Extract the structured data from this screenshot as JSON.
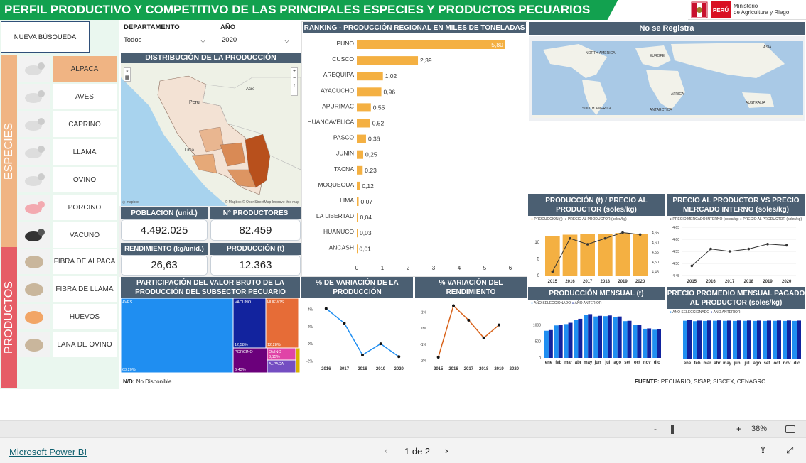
{
  "header": {
    "title": "PERFIL PRODUCTIVO Y COMPETITIVO DE LAS PRINCIPALES ESPECIES Y PRODUCTOS PECUARIOS",
    "logo_country": "PERÚ",
    "logo_ministry_1": "Ministerio",
    "logo_ministry_2": "de Agricultura y Riego"
  },
  "filters": {
    "new_search": "NUEVA BÚSQUEDA",
    "dept_label": "DEPARTAMENTO",
    "dept_value": "Todos",
    "year_label": "AÑO",
    "year_value": "2020"
  },
  "side": {
    "especies": "ESPECIES",
    "productos": "PRODUCTOS"
  },
  "species": [
    "ALPACA",
    "AVES",
    "CAPRINO",
    "LLAMA",
    "OVINO",
    "PORCINO",
    "VACUNO"
  ],
  "products": [
    "FIBRA DE ALPACA",
    "FIBRA DE LLAMA",
    "HUEVOS",
    "LANA DE OVINO"
  ],
  "map": {
    "title": "DISTRIBUCIÓN DE LA PRODUCCIÓN",
    "country": "Peru",
    "city": "Lima",
    "region_label": "Acre",
    "attribution": "© Mapbox © OpenStreetMap Improve this map"
  },
  "kpis": {
    "poblacion_label": "POBLACION (unid.)",
    "poblacion_value": "4.492.025",
    "productores_label": "N° PRODUCTORES",
    "productores_value": "82.459",
    "rendimiento_label": "RENDIMIENTO (kg/unid.)",
    "rendimiento_value": "26,63",
    "produccion_label": "PRODUCCIÓN (t)",
    "produccion_value": "12.363"
  },
  "ranking": {
    "title": "RANKING - PRODUCCIÓN REGIONAL EN MILES DE TONELADAS",
    "xticks": [
      "0",
      "1",
      "2",
      "3",
      "4",
      "5",
      "6"
    ]
  },
  "world": {
    "title": "No se Registra",
    "labels": [
      "NORTH AMERICA",
      "EUROPE",
      "ASIA",
      "AFRICA",
      "SOUTH AMERICA",
      "AUSTRALIA",
      "ANTARCTICA"
    ]
  },
  "prod_price": {
    "title": "PRODUCCIÓN (t) / PRECIO AL PRODUCTOR (soles/kg)",
    "legend_a": "PRODUCCIÓN (t)",
    "legend_b": "PRECIO AL PRODUCTOR (soles/kg)"
  },
  "price_vs": {
    "title": "PRECIO AL PRODUCTOR VS PRECIO MERCADO INTERNO (soles/kg)",
    "legend_a": "PRECIO MERCADO INTERNO (soles/kg)",
    "legend_b": "PRECIO AL PRODUCTOR (soles/kg)"
  },
  "treemap": {
    "title": "PARTICIPACIÓN DEL VALOR BRUTO DE LA PRODUCCIÓN DEL SUBSECTOR PECUARIO"
  },
  "var_prod": {
    "title": "% DE VARIACIÓN DE LA PRODUCCIÓN"
  },
  "var_rend": {
    "title": "% VARIACIÓN DEL RENDIMIENTO"
  },
  "monthly": {
    "title": "PRODUCCIÓN MENSUAL (t)",
    "legend_a": "AÑO SELECCIONADO",
    "legend_b": "AÑO ANTERIOR"
  },
  "avgprice": {
    "title": "PRECIO PROMEDIO MENSUAL PAGADO AL PRODUCTOR (soles/kg)",
    "legend_a": "AÑO SELECCIONADO",
    "legend_b": "AÑO ANTERIOR"
  },
  "notes": {
    "nd": "N/D:",
    "nd_text": "No Disponible",
    "fuente": "FUENTE:",
    "fuente_text": "PECUARIO, SISAP, SISCEX, CENAGRO"
  },
  "footer": {
    "brand": "Microsoft Power BI",
    "page": "1 de 2",
    "zoom": "38%",
    "zoom_minus": "-",
    "zoom_plus": "+"
  },
  "chart_data": [
    {
      "type": "bar",
      "id": "ranking",
      "title": "RANKING - PRODUCCIÓN REGIONAL EN MILES DE TONELADAS",
      "categories": [
        "PUNO",
        "CUSCO",
        "AREQUIPA",
        "AYACUCHO",
        "APURIMAC",
        "HUANCAVELICA",
        "PASCO",
        "JUNIN",
        "TACNA",
        "MOQUEGUA",
        "LIMA",
        "LA LIBERTAD",
        "HUANUCO",
        "ANCASH"
      ],
      "values": [
        5.8,
        2.39,
        1.02,
        0.96,
        0.55,
        0.52,
        0.36,
        0.25,
        0.23,
        0.12,
        0.07,
        0.04,
        0.03,
        0.01
      ],
      "labels": [
        "5,80",
        "2,39",
        "1,02",
        "0,96",
        "0,55",
        "0,52",
        "0,36",
        "0,25",
        "0,23",
        "0,12",
        "0,07",
        "0,04",
        "0,03",
        "0,01"
      ],
      "xlim": [
        0,
        6
      ],
      "color": "#f4b042"
    },
    {
      "type": "bar",
      "id": "prod_price",
      "categories": [
        "2015",
        "2016",
        "2017",
        "2018",
        "2019",
        "2020"
      ],
      "series": [
        {
          "name": "PRODUCCIÓN (t)",
          "values": [
            11800,
            12200,
            12500,
            12400,
            12700,
            12363
          ]
        },
        {
          "name": "PRECIO AL PRODUCTOR (soles/kg)",
          "values": [
            4.45,
            4.62,
            4.59,
            4.62,
            4.65,
            4.64
          ]
        }
      ],
      "yticks_left": [
        "0",
        "5",
        "10"
      ],
      "yticks_right": [
        "4,45",
        "4,50",
        "4,55",
        "4,60",
        "4,65"
      ],
      "y2lim": [
        4.43,
        4.67
      ]
    },
    {
      "type": "line",
      "id": "price_vs",
      "categories": [
        "2015",
        "2016",
        "2017",
        "2018",
        "2019",
        "2020"
      ],
      "series": [
        {
          "name": "PRECIO AL PRODUCTOR (soles/kg)",
          "values": [
            4.49,
            4.56,
            4.55,
            4.56,
            4.58,
            4.575
          ]
        }
      ],
      "yticks": [
        "4,45",
        "4,50",
        "4,55",
        "4,60",
        "4,65"
      ],
      "ylim": [
        4.45,
        4.65
      ]
    },
    {
      "type": "treemap",
      "id": "vbp",
      "items": [
        {
          "name": "AVES",
          "label": "63,20%",
          "value": 63.2,
          "color": "#1f8ef1"
        },
        {
          "name": "VACUNO",
          "label": "12,58%",
          "value": 12.58,
          "color": "#12239e"
        },
        {
          "name": "HUEVOS",
          "label": "12,28%",
          "value": 12.28,
          "color": "#e66c37"
        },
        {
          "name": "PORCINO",
          "label": "6,43%",
          "value": 6.43,
          "color": "#6b007b"
        },
        {
          "name": "OVINO",
          "label": "3,15%",
          "value": 3.15,
          "color": "#e044a7"
        },
        {
          "name": "ALPACA",
          "label": "",
          "value": 1.5,
          "color": "#744ec2"
        },
        {
          "name": "",
          "label": "",
          "value": 0.86,
          "color": "#d9b300"
        }
      ]
    },
    {
      "type": "line",
      "id": "var_prod",
      "categories": [
        "2016",
        "2017",
        "2018",
        "2019",
        "2020"
      ],
      "values": [
        4.1,
        2.4,
        -1.3,
        0.0,
        -1.5
      ],
      "yticks": [
        "4%",
        "2%",
        "0%",
        "-2%"
      ],
      "ylim": [
        -2.3,
        4.8
      ],
      "color": "#1f8ef1"
    },
    {
      "type": "line",
      "id": "var_rend",
      "categories": [
        "2015",
        "2016",
        "2017",
        "2018",
        "2019",
        "2020"
      ],
      "values": [
        -1.8,
        1.4,
        0.5,
        -0.6,
        0.2
      ],
      "yticks": [
        "1%",
        "0%",
        "-1%",
        "-2%"
      ],
      "ylim": [
        -2.2,
        1.6
      ],
      "color": "#d9631b"
    },
    {
      "type": "bar",
      "id": "monthly",
      "categories": [
        "ene",
        "feb",
        "mar",
        "abr",
        "may",
        "jun",
        "jul",
        "ago",
        "set",
        "oct",
        "nov",
        "dic"
      ],
      "series": [
        {
          "name": "AÑO SELECCIONADO",
          "values": [
            820,
            980,
            1020,
            1150,
            1290,
            1250,
            1260,
            1240,
            1110,
            990,
            880,
            850
          ]
        },
        {
          "name": "AÑO ANTERIOR",
          "values": [
            840,
            990,
            1060,
            1180,
            1320,
            1270,
            1280,
            1250,
            1120,
            1000,
            890,
            860
          ]
        }
      ],
      "yticks": [
        "0",
        "500",
        "1000"
      ],
      "ylim": [
        0,
        1500
      ]
    },
    {
      "type": "bar",
      "id": "avgprice",
      "categories": [
        "ene",
        "feb",
        "mar",
        "abr",
        "may",
        "jun",
        "jul",
        "ago",
        "set",
        "oct",
        "nov",
        "dic"
      ],
      "series": [
        {
          "name": "AÑO SELECCIONADO",
          "values": [
            4.6,
            4.55,
            4.58,
            4.6,
            4.59,
            4.58,
            4.59,
            4.58,
            4.58,
            4.59,
            4.58,
            4.58
          ]
        },
        {
          "name": "AÑO ANTERIOR",
          "values": [
            4.7,
            4.62,
            4.63,
            4.64,
            4.62,
            4.63,
            4.63,
            4.62,
            4.62,
            4.63,
            4.63,
            4.62
          ]
        }
      ],
      "ylim": [
        0,
        5
      ]
    }
  ]
}
